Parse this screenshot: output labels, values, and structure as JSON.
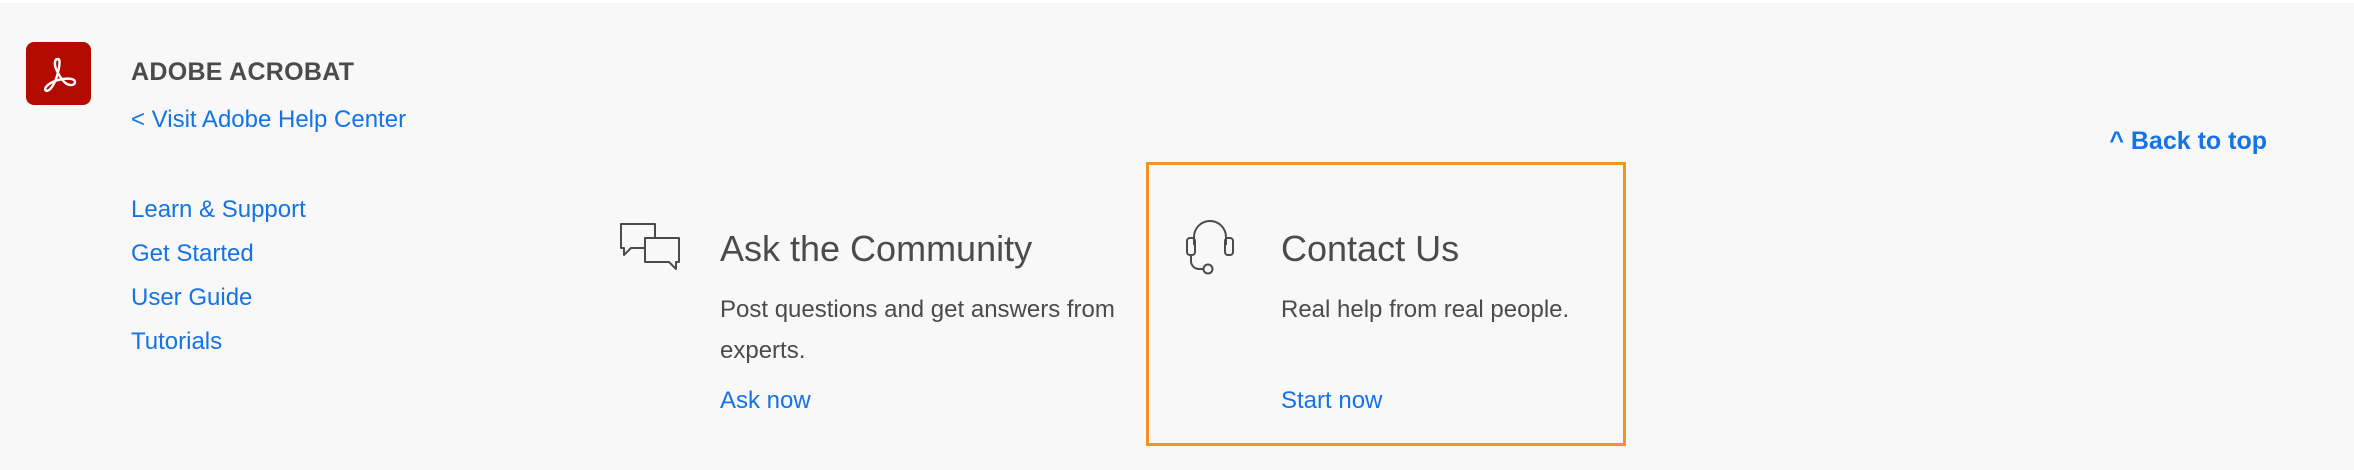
{
  "brand": {
    "logo_icon": "adobe-acrobat-logo",
    "logo_color": "#b30b00",
    "product_name": "ADOBE ACROBAT",
    "help_center_link": "< Visit Adobe Help Center"
  },
  "back_to_top": "^ Back to top",
  "side_nav": {
    "items": [
      {
        "label": "Learn & Support"
      },
      {
        "label": "Get Started"
      },
      {
        "label": "User Guide"
      },
      {
        "label": "Tutorials"
      }
    ]
  },
  "community_card": {
    "icon": "chat-bubbles-icon",
    "title": "Ask the Community",
    "description": "Post questions and get answers from experts.",
    "action": "Ask now"
  },
  "contact_card": {
    "icon": "headset-icon",
    "title": "Contact Us",
    "description": "Real help from real people.",
    "action": "Start now",
    "highlight_color": "#f29423"
  },
  "colors": {
    "link": "#1473e6",
    "text": "#4b4b4b",
    "background": "#f8f8f8"
  }
}
